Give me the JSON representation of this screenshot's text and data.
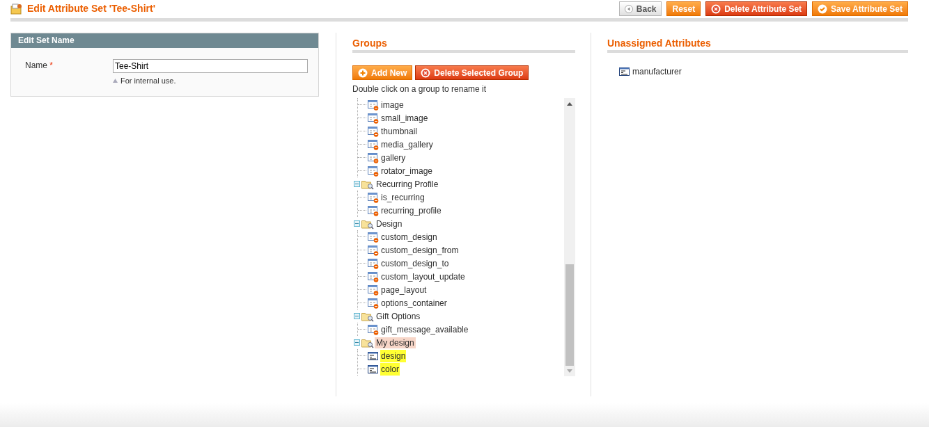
{
  "page_title": "Edit Attribute Set 'Tee-Shirt'",
  "header_buttons": [
    {
      "label": "Back",
      "kind": "back"
    },
    {
      "label": "Reset",
      "kind": "reset"
    },
    {
      "label": "Delete Attribute Set",
      "kind": "delete"
    },
    {
      "label": "Save Attribute Set",
      "kind": "save"
    }
  ],
  "edit_set_name": {
    "title": "Edit Set Name",
    "field_label": "Name",
    "required_mark": "*",
    "value": "Tee-Shirt",
    "note": "For internal use."
  },
  "groups": {
    "title": "Groups",
    "buttons": [
      {
        "label": "Add New",
        "kind": "add"
      },
      {
        "label": "Delete Selected Group",
        "kind": "delete"
      }
    ],
    "hint": "Double click on a group to rename it",
    "tree": [
      {
        "children": [
          {
            "label": "image",
            "kind": "system"
          },
          {
            "label": "small_image",
            "kind": "system"
          },
          {
            "label": "thumbnail",
            "kind": "system"
          },
          {
            "label": "media_gallery",
            "kind": "system"
          },
          {
            "label": "gallery",
            "kind": "system"
          },
          {
            "label": "rotator_image",
            "kind": "system"
          }
        ]
      },
      {
        "label": "Recurring Profile",
        "expanded": true,
        "selected": false,
        "children": [
          {
            "label": "is_recurring",
            "kind": "system"
          },
          {
            "label": "recurring_profile",
            "kind": "system"
          }
        ]
      },
      {
        "label": "Design",
        "expanded": true,
        "selected": false,
        "children": [
          {
            "label": "custom_design",
            "kind": "system"
          },
          {
            "label": "custom_design_from",
            "kind": "system"
          },
          {
            "label": "custom_design_to",
            "kind": "system"
          },
          {
            "label": "custom_layout_update",
            "kind": "system"
          },
          {
            "label": "page_layout",
            "kind": "system"
          },
          {
            "label": "options_container",
            "kind": "system"
          }
        ]
      },
      {
        "label": "Gift Options",
        "expanded": true,
        "selected": false,
        "children": [
          {
            "label": "gift_message_available",
            "kind": "system"
          }
        ]
      },
      {
        "label": "My design",
        "expanded": true,
        "selected": true,
        "children": [
          {
            "label": "design",
            "kind": "custom"
          },
          {
            "label": "color",
            "kind": "custom"
          }
        ]
      }
    ]
  },
  "unassigned": {
    "title": "Unassigned Attributes",
    "items": [
      {
        "label": "manufacturer",
        "kind": "plain"
      }
    ]
  }
}
